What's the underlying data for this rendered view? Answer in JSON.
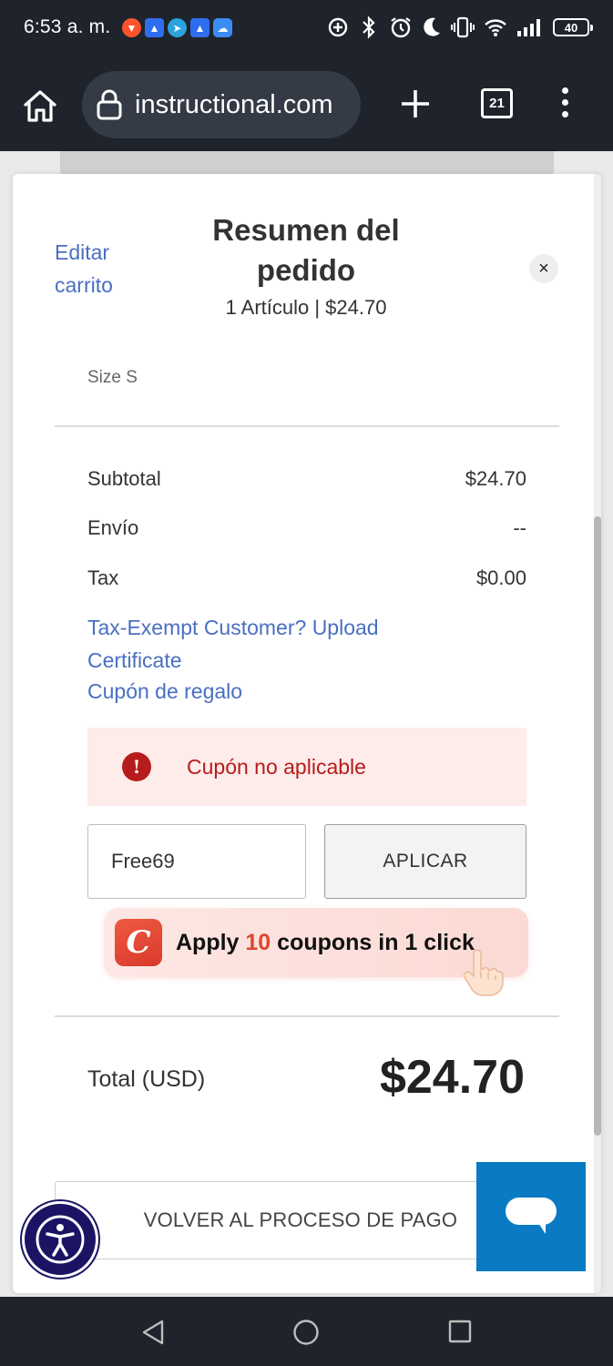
{
  "status_bar": {
    "time": "6:53 a. m.",
    "battery": "40"
  },
  "browser": {
    "url": "instructional.com",
    "tab_count": "21"
  },
  "modal": {
    "edit_cart_label": "Editar carrito",
    "title": "Resumen del pedido",
    "subtitle": "1 Artículo | $24.70",
    "close_label": "×",
    "item_size": "Size S",
    "summary": {
      "subtotal_label": "Subtotal",
      "subtotal_value": "$24.70",
      "shipping_label": "Envío",
      "shipping_value": "--",
      "tax_label": "Tax",
      "tax_value": "$0.00"
    },
    "tax_exempt_link": "Tax-Exempt Customer? Upload Certificate",
    "gift_coupon_link": "Cupón de regalo",
    "error": {
      "icon": "!",
      "message": "Cupón no aplicable"
    },
    "coupon_input_value": "Free69",
    "apply_button": "APLICAR",
    "total_label": "Total (USD)",
    "total_value": "$24.70",
    "back_button": "VOLVER AL PROCESO DE PAGO"
  },
  "coupon_extension": {
    "logo_letter": "C",
    "text_before": "Apply ",
    "count": "10",
    "text_after": " coupons in 1 click"
  },
  "colors": {
    "link": "#4a6fc1",
    "error": "#b71c1c",
    "chat": "#0a7bc2",
    "accessibility": "#1b1464",
    "coupon_accent": "#e0462e"
  }
}
